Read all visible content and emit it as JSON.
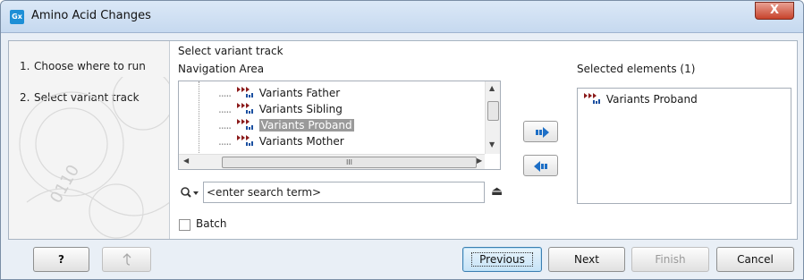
{
  "window": {
    "app_icon_text": "Gx",
    "title": "Amino Acid Changes",
    "close_glyph": "X"
  },
  "steps": [
    {
      "num": "1.",
      "label": "Choose where to run"
    },
    {
      "num": "2.",
      "label": "Select variant track"
    }
  ],
  "main": {
    "section_title": "Select variant track",
    "navigation_label": "Navigation Area",
    "selected_label": "Selected elements (1)",
    "tree_items": [
      {
        "label": "Variants Father",
        "selected": false
      },
      {
        "label": "Variants Sibling",
        "selected": false
      },
      {
        "label": "Variants Proband",
        "selected": true
      },
      {
        "label": "Variants Mother",
        "selected": false
      }
    ],
    "selected_items": [
      "Variants Proband"
    ],
    "search_placeholder": "<enter search term>",
    "batch_label": "Batch",
    "batch_checked": false,
    "scroll_thumb_grip": "III"
  },
  "footer": {
    "help": "?",
    "previous": "Previous",
    "next": "Next",
    "finish": "Finish",
    "cancel": "Cancel"
  },
  "colors": {
    "title_bar": "#c6d9ef",
    "close_button": "#c7432c",
    "variant_icon_arrow": "#8b1a1a",
    "variant_icon_bars": "#1a4fa0",
    "move_arrow": "#1e6fc6",
    "selection_highlight": "#9a9a9a"
  }
}
